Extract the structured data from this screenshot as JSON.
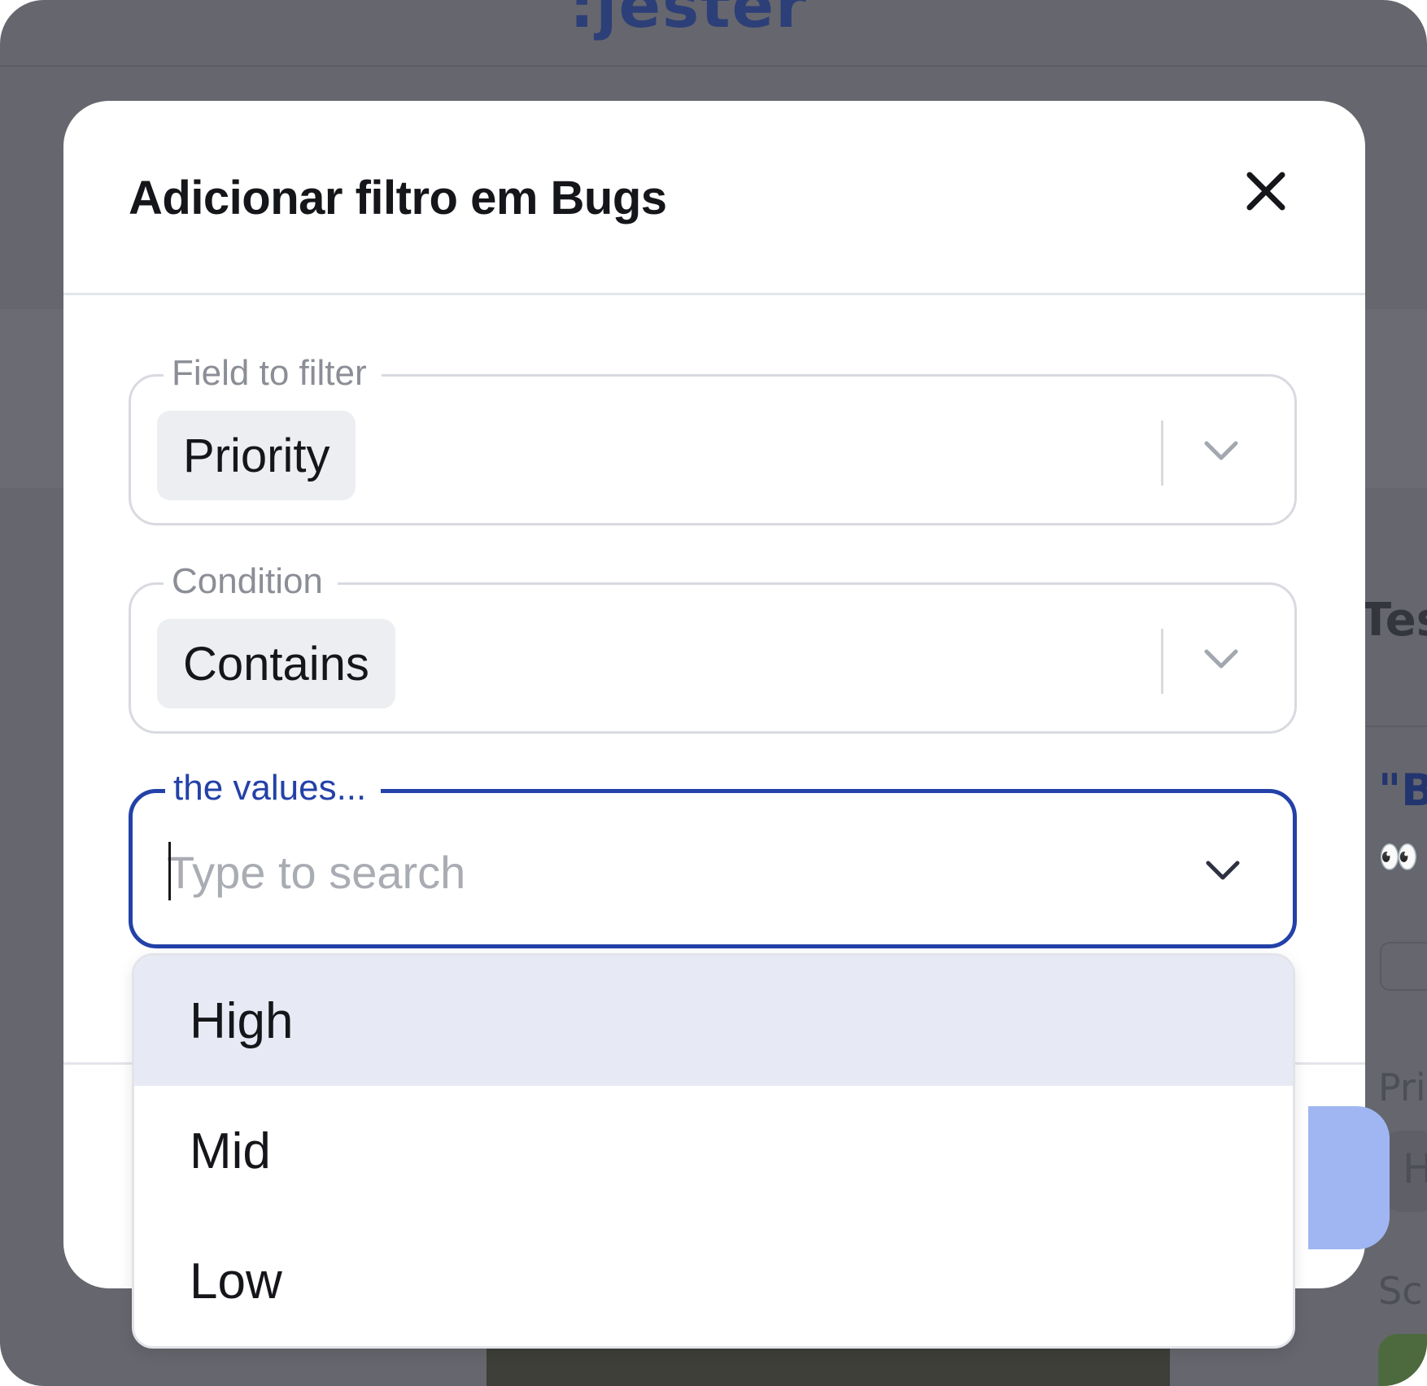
{
  "background": {
    "brand": ":jester",
    "partial_texts": {
      "heading": "Tes",
      "quote": "\"B",
      "label_priority": "Pri",
      "chip_value": "H",
      "label_score": "Sc"
    },
    "emoji": "👀"
  },
  "modal": {
    "title": "Adicionar filtro em Bugs",
    "close_icon": "close-icon",
    "fields": {
      "field_to_filter": {
        "legend": "Field to filter",
        "value": "Priority"
      },
      "condition": {
        "legend": "Condition",
        "value": "Contains"
      },
      "values": {
        "legend": "the values...",
        "placeholder": "Type to search",
        "value": ""
      }
    },
    "dropdown": {
      "options": [
        {
          "label": "High",
          "highlighted": true
        },
        {
          "label": "Mid",
          "highlighted": false
        },
        {
          "label": "Low",
          "highlighted": false
        }
      ]
    }
  },
  "colors": {
    "accent": "#2341a8",
    "overlay": "#66676e",
    "highlight": "#e7eaf5",
    "primary_button": "#9fb6f2"
  }
}
